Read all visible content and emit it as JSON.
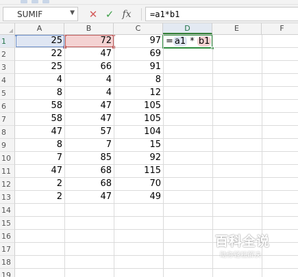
{
  "formula_bar": {
    "name_box": "SUMIF",
    "cancel_icon": "✕",
    "enter_icon": "✓",
    "fx_label": "fx",
    "formula": "=a1*b1"
  },
  "columns": [
    "A",
    "B",
    "C",
    "D",
    "E",
    "F"
  ],
  "active_column": "D",
  "rows": [
    {
      "n": "1",
      "a": "25",
      "b": "72",
      "c": "97"
    },
    {
      "n": "2",
      "a": "22",
      "b": "47",
      "c": "69"
    },
    {
      "n": "3",
      "a": "25",
      "b": "66",
      "c": "91"
    },
    {
      "n": "4",
      "a": "4",
      "b": "4",
      "c": "8"
    },
    {
      "n": "5",
      "a": "8",
      "b": "4",
      "c": "12"
    },
    {
      "n": "6",
      "a": "58",
      "b": "47",
      "c": "105"
    },
    {
      "n": "7",
      "a": "58",
      "b": "47",
      "c": "105"
    },
    {
      "n": "8",
      "a": "47",
      "b": "57",
      "c": "104"
    },
    {
      "n": "9",
      "a": "8",
      "b": "7",
      "c": "15"
    },
    {
      "n": "10",
      "a": "7",
      "b": "85",
      "c": "92"
    },
    {
      "n": "11",
      "a": "47",
      "b": "68",
      "c": "115"
    },
    {
      "n": "12",
      "a": "2",
      "b": "68",
      "c": "70"
    },
    {
      "n": "13",
      "a": "2",
      "b": "47",
      "c": "49"
    },
    {
      "n": "14"
    },
    {
      "n": "15"
    },
    {
      "n": "16"
    },
    {
      "n": "17"
    },
    {
      "n": "18"
    },
    {
      "n": "19"
    }
  ],
  "active_row": "1",
  "edit_cell": {
    "eq": "=",
    "ref_a": "a1",
    "op": " * ",
    "ref_b": "b1"
  },
  "watermark": {
    "title": "百科全说",
    "subtitle": "助你轻松解决"
  },
  "colors": {
    "active_green": "#2e8b3d",
    "ref_blue": "#6d8fc9",
    "ref_red": "#c25b5b"
  }
}
